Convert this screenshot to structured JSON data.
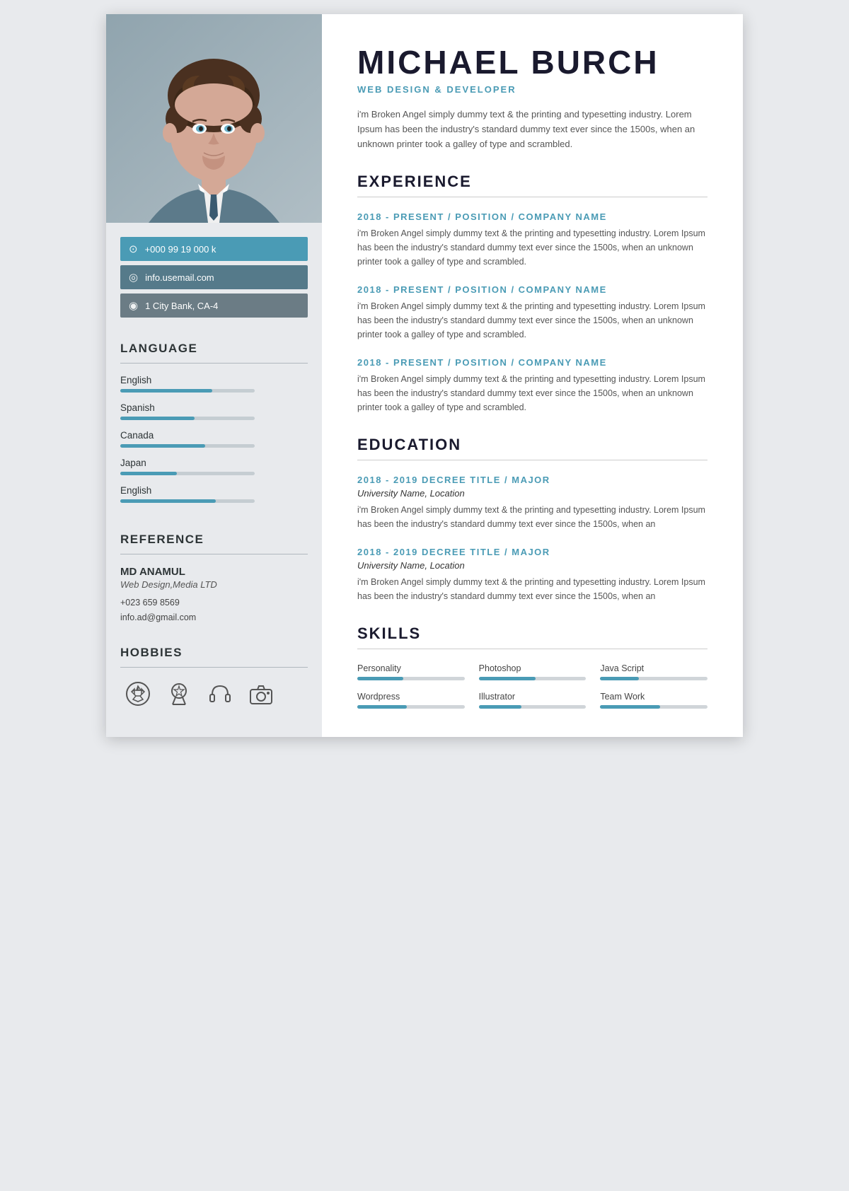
{
  "sidebar": {
    "contact": {
      "phone": "+000 99 19 000 k",
      "email": "info.usemail.com",
      "address": "1 City Bank, CA-4"
    },
    "language_section_title": "LANGUAGE",
    "languages": [
      {
        "label": "English",
        "fill_width": 130
      },
      {
        "label": "Spanish",
        "fill_width": 105
      },
      {
        "label": "Canada",
        "fill_width": 120
      },
      {
        "label": "Japan",
        "fill_width": 80
      },
      {
        "label": "English",
        "fill_width": 135
      }
    ],
    "reference_section_title": "REFERENCE",
    "reference": {
      "name": "MD ANAMUL",
      "title": "Web Design,Media LTD",
      "phone": "+023 659 8569",
      "email": "info.ad@gmail.com"
    },
    "hobbies_section_title": "HOBBIES",
    "hobbies": [
      "football",
      "award",
      "headphones",
      "camera"
    ]
  },
  "main": {
    "name": "MICHAEL BURCH",
    "title": "WEB DESIGN & DEVELOPER",
    "bio": "i'm Broken Angel simply dummy text & the printing and typesetting industry. Lorem Ipsum has been the industry's standard dummy text ever since the 1500s, when an unknown printer took a galley of type and scrambled.",
    "experience_section_title": "EXPERIENCE",
    "experiences": [
      {
        "heading": "2018 - PRESENT / POSITION / COMPANY NAME",
        "text": "i'm Broken Angel simply dummy text & the printing and typesetting industry. Lorem Ipsum has been the industry's standard dummy text ever since the 1500s, when an unknown printer took a galley of type and scrambled."
      },
      {
        "heading": "2018 - PRESENT / POSITION / COMPANY NAME",
        "text": "i'm Broken Angel simply dummy text & the printing and typesetting industry. Lorem Ipsum has been the industry's standard dummy text ever since the 1500s, when an unknown printer took a galley of type and scrambled."
      },
      {
        "heading": "2018 - PRESENT / POSITION / COMPANY NAME",
        "text": "i'm Broken Angel simply dummy text & the printing and typesetting industry. Lorem Ipsum has been the industry's standard dummy text ever since the 1500s, when an unknown printer took a galley of type and scrambled."
      }
    ],
    "education_section_title": "EDUCATION",
    "educations": [
      {
        "heading": "2018 - 2019 DECREE TITLE / MAJOR",
        "subtitle": "University Name, Location",
        "text": "i'm Broken Angel simply dummy text & the printing and typesetting industry. Lorem Ipsum has been the industry's standard dummy text ever since the 1500s, when an"
      },
      {
        "heading": "2018 - 2019 DECREE TITLE / MAJOR",
        "subtitle": "University Name, Location",
        "text": "i'm Broken Angel simply dummy text & the printing and typesetting industry. Lorem Ipsum has been the industry's standard dummy text ever since the 1500s, when an"
      }
    ],
    "skills_section_title": "SKILLS",
    "skills": [
      {
        "label": "Personality",
        "fill_width": 65
      },
      {
        "label": "Photoshop",
        "fill_width": 80
      },
      {
        "label": "Java Script",
        "fill_width": 55
      },
      {
        "label": "Wordpress",
        "fill_width": 70
      },
      {
        "label": "Illustrator",
        "fill_width": 60
      },
      {
        "label": "Team Work",
        "fill_width": 85
      }
    ]
  },
  "colors": {
    "accent": "#4a9bb5",
    "dark": "#1a1a2e",
    "text": "#555555"
  }
}
